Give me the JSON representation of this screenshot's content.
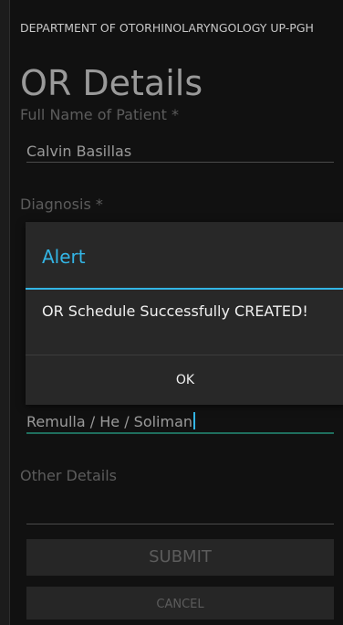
{
  "header": {
    "department": "DEPARTMENT OF OTORHINOLARYNGOLOGY UP-PGH",
    "title": "OR Details"
  },
  "form": {
    "patient_label": "Full Name of Patient *",
    "patient_value": "Calvin Basillas",
    "diagnosis_label": "Diagnosis *",
    "surgeons_value": "Remulla / He / Soliman",
    "other_label": "Other Details",
    "submit_label": "SUBMIT",
    "cancel_label": "CANCEL"
  },
  "dialog": {
    "title": "Alert",
    "message": "OR Schedule Successfully CREATED!",
    "ok_label": "OK"
  },
  "colors": {
    "accent": "#33b5e5",
    "background": "#111111",
    "dialog_bg": "#282828"
  }
}
